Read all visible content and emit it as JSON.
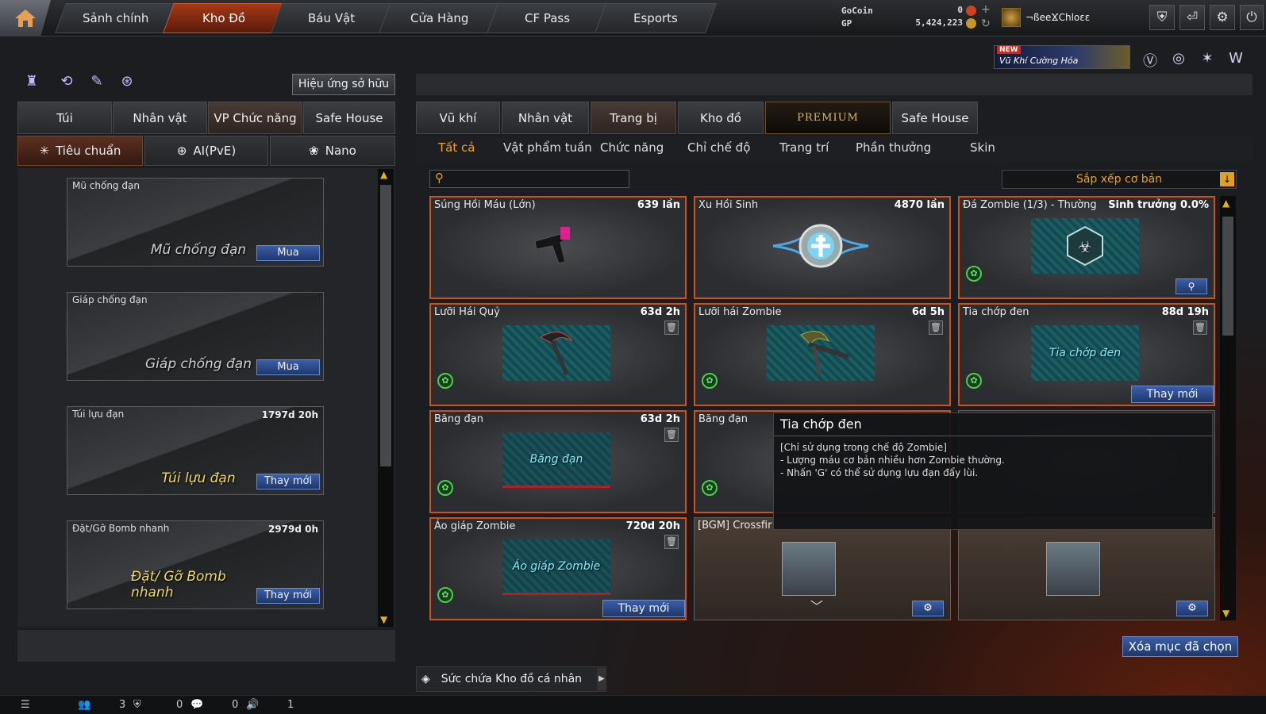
{
  "nav": {
    "tabs": [
      "Sảnh chính",
      "Kho Đồ",
      "Báu Vật",
      "Cửa Hàng",
      "CF Pass",
      "Esports"
    ],
    "active": "Kho Đồ"
  },
  "resources": {
    "gocoin_label": "GoCoin",
    "gocoin_value": "0",
    "gp_label": "GP",
    "gp_value": "5,424,223"
  },
  "user": {
    "name": "¬ßeeϪChloεε"
  },
  "promo": {
    "badge": "NEW",
    "text": "Vũ Khí Cường Hóa"
  },
  "left": {
    "effect_button": "Hiệu ứng sở hữu",
    "tabs": [
      "Túi",
      "Nhân vật",
      "VP Chức năng",
      "Safe House"
    ],
    "subtabs": [
      "Tiêu chuẩn",
      "AI(PvE)",
      "Nano"
    ],
    "items": [
      {
        "name": "Mũ chống đạn",
        "time": "",
        "art": "Mũ chống đạn",
        "button": "Mua"
      },
      {
        "name": "Giáp chống đạn",
        "time": "",
        "art": "Giáp chống đạn",
        "button": "Mua"
      },
      {
        "name": "Túi lựu đạn",
        "time": "1797d 20h",
        "art": "Túi lựu đạn",
        "button": "Thay mới"
      },
      {
        "name": "Đặt/Gỡ Bomb nhanh",
        "time": "2979d 0h",
        "art": "Đặt/ Gỡ Bomb nhanh",
        "button": "Thay mới"
      }
    ]
  },
  "right": {
    "tabs": [
      "Vũ khí",
      "Nhân vật",
      "Trang bị",
      "Kho đồ",
      "PREMIUM",
      "Safe House"
    ],
    "subtabs": [
      "Tất cả",
      "Vật phẩm tuần",
      "Chức năng",
      "Chỉ chế độ",
      "Trang trí",
      "Phần thưởng",
      "Skin"
    ],
    "sort_label": "Sắp xếp cơ bản",
    "cards": [
      {
        "name": "Súng Hồi Máu (Lớn)",
        "time": "639 lần"
      },
      {
        "name": "Xu Hồi Sinh",
        "time": "4870 lần"
      },
      {
        "name": "Đá Zombie (1/3) - Thường",
        "time": "Sinh trưởng 0.0%"
      },
      {
        "name": "Lưỡi Hái Quỷ",
        "time": "63d 2h"
      },
      {
        "name": "Lưỡi hái Zombie",
        "time": "6d 5h"
      },
      {
        "name": "Tia chớp đen",
        "time": "88d 19h",
        "art": "Tia chớp đen",
        "button": "Thay mới"
      },
      {
        "name": "Băng đạn",
        "time": "63d 2h",
        "art": "Băng đạn"
      },
      {
        "name": "Băng đạn",
        "time": ""
      },
      {
        "name": "Áo giáp Zombie",
        "time": "720d 20h",
        "art": "Áo giáp Zombie",
        "button": "Thay mới"
      },
      {
        "name": "[BGM] Crossfir",
        "time": ""
      },
      {
        "name": "",
        "time": ""
      }
    ],
    "clear_button": "Xóa mục đã chọn",
    "capacity": "Sức chứa Kho đồ cá nhân"
  },
  "tooltip": {
    "title": "Tia chớp đen",
    "lines": [
      "[Chỉ sử dụng trong chế độ Zombie]",
      "- Lượng máu cơ bản nhiều hơn Zombie thường.",
      "- Nhấn 'G' có thể sử dụng lựu đạn đẩy lùi."
    ]
  },
  "status": {
    "count1": "3",
    "count2": "0",
    "count3": "0",
    "count4": "1"
  }
}
